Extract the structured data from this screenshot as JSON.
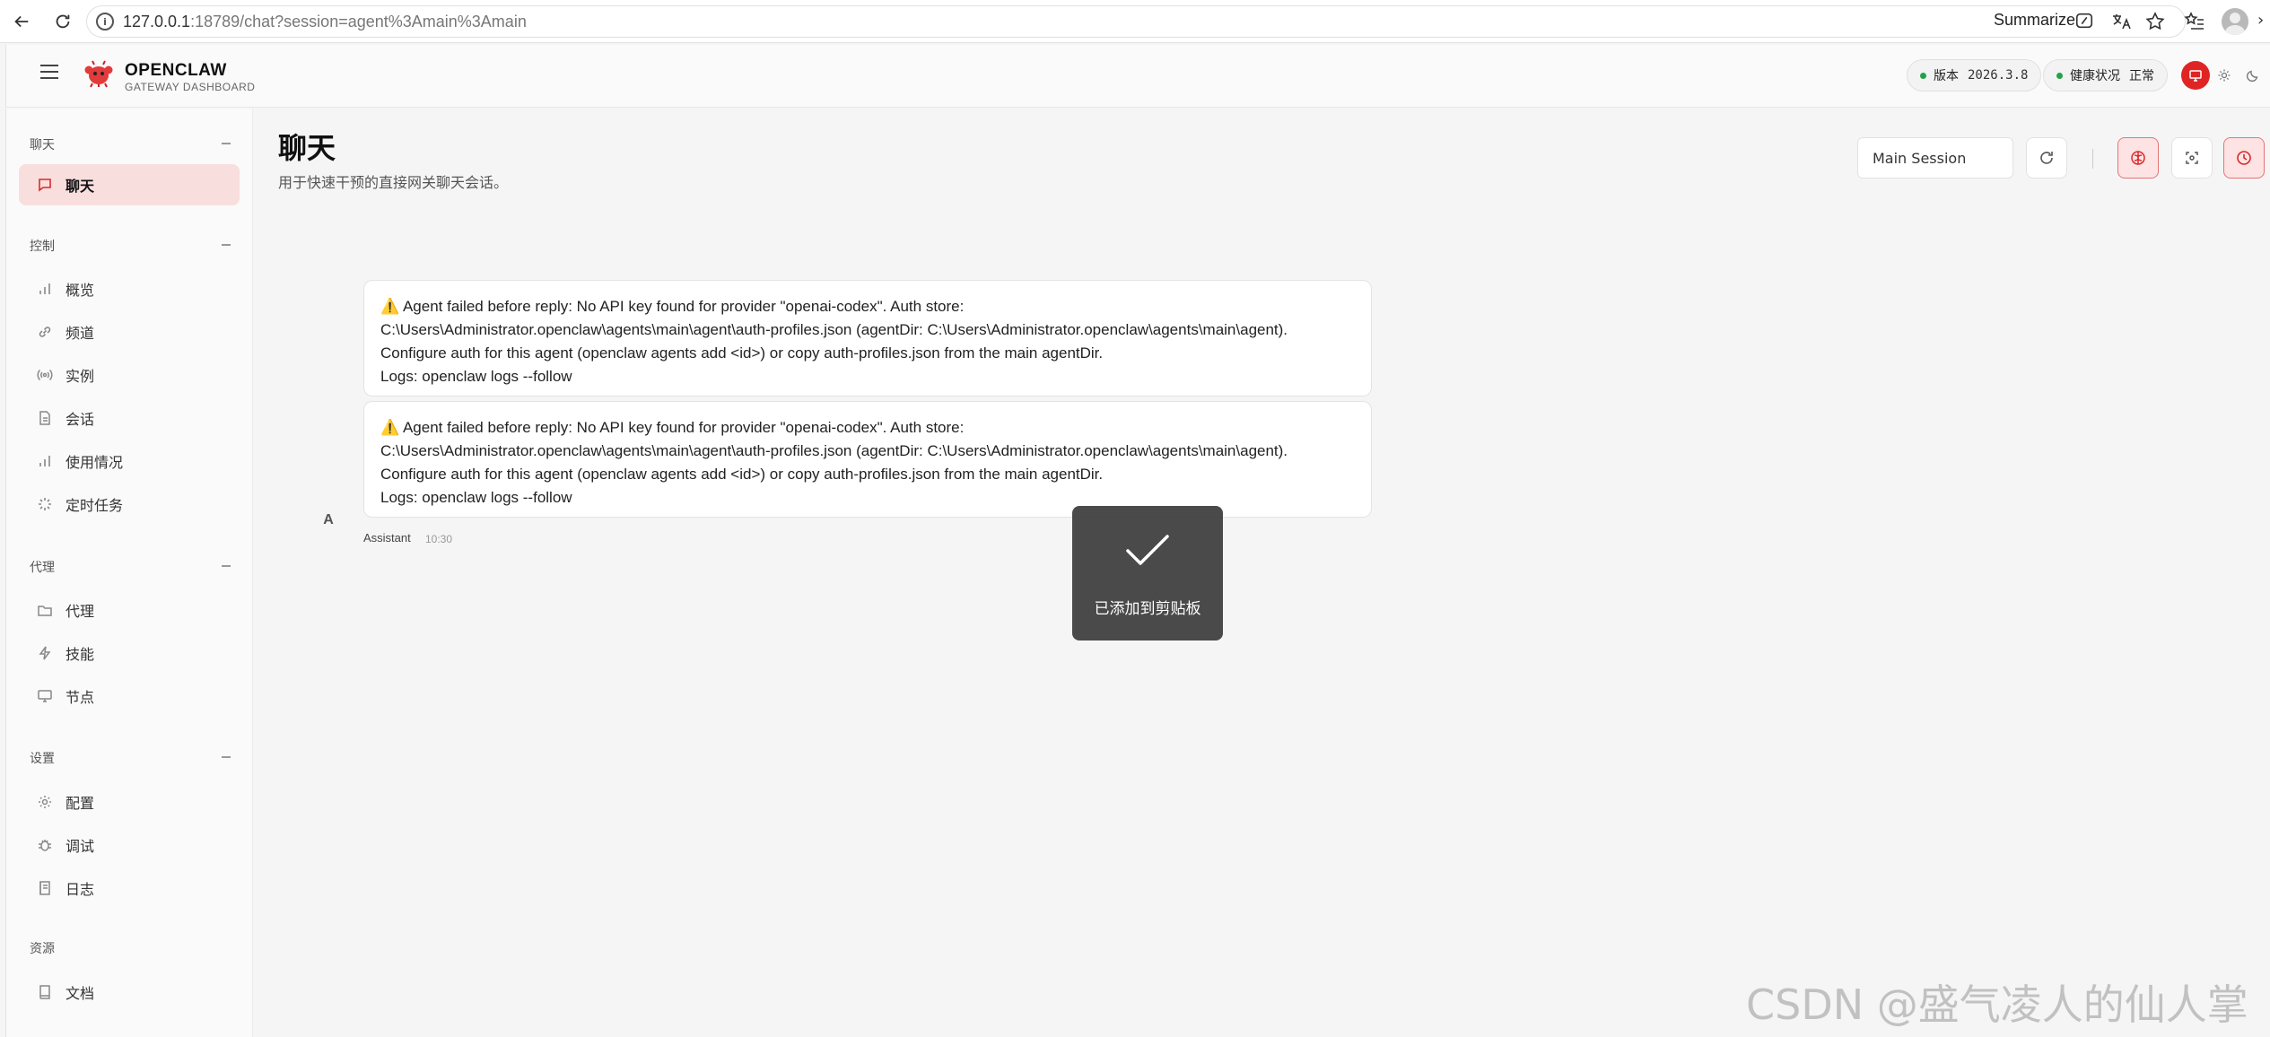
{
  "browser": {
    "url_host": "127.0.0.1",
    "url_rest": ":18789/chat?session=agent%3Amain%3Amain",
    "summarize_label": "Summarize"
  },
  "app": {
    "brand_title": "OPENCLAW",
    "brand_subtitle": "GATEWAY DASHBOARD",
    "version_label": "版本",
    "version_value": "2026.3.8",
    "health_label": "健康状况",
    "health_value": "正常"
  },
  "sidebar": {
    "sections": [
      {
        "title": "聊天",
        "items": [
          {
            "label": "聊天",
            "icon": "chat-bubble-icon",
            "active": true
          }
        ]
      },
      {
        "title": "控制",
        "items": [
          {
            "label": "概览",
            "icon": "bar-chart-icon"
          },
          {
            "label": "频道",
            "icon": "link-icon"
          },
          {
            "label": "实例",
            "icon": "broadcast-icon"
          },
          {
            "label": "会话",
            "icon": "document-icon"
          },
          {
            "label": "使用情况",
            "icon": "bar-chart-icon"
          },
          {
            "label": "定时任务",
            "icon": "spinner-icon"
          }
        ]
      },
      {
        "title": "代理",
        "items": [
          {
            "label": "代理",
            "icon": "folder-icon"
          },
          {
            "label": "技能",
            "icon": "lightning-icon"
          },
          {
            "label": "节点",
            "icon": "monitor-icon"
          }
        ]
      },
      {
        "title": "设置",
        "items": [
          {
            "label": "配置",
            "icon": "gear-icon"
          },
          {
            "label": "调试",
            "icon": "bug-icon"
          },
          {
            "label": "日志",
            "icon": "log-icon"
          }
        ]
      },
      {
        "title": "资源",
        "items": [
          {
            "label": "文档",
            "icon": "book-icon"
          }
        ]
      }
    ]
  },
  "main": {
    "title": "聊天",
    "subtitle": "用于快速干预的直接网关聊天会话。",
    "session_select_value": "Main Session",
    "messages": [
      {
        "lines": [
          "⚠️ Agent failed before reply: No API key found for provider \"openai-codex\". Auth store:",
          "C:\\Users\\Administrator.openclaw\\agents\\main\\agent\\auth-profiles.json (agentDir: C:\\Users\\Administrator.openclaw\\agents\\main\\agent).",
          "Configure auth for this agent (openclaw agents add <id>) or copy auth-profiles.json from the main agentDir.",
          "Logs: openclaw logs --follow"
        ]
      },
      {
        "lines": [
          "⚠️ Agent failed before reply: No API key found for provider \"openai-codex\". Auth store:",
          "C:\\Users\\Administrator.openclaw\\agents\\main\\agent\\auth-profiles.json (agentDir: C:\\Users\\Administrator.openclaw\\agents\\main\\agent).",
          "Configure auth for this agent (openclaw agents add <id>) or copy auth-profiles.json from the main agentDir.",
          "Logs: openclaw logs --follow"
        ]
      }
    ],
    "avatar_letter": "A",
    "sender_name": "Assistant",
    "sender_time": "10:30"
  },
  "toast": {
    "text": "已添加到剪贴板"
  },
  "watermark": "CSDN @盛气凌人的仙人掌",
  "colors": {
    "accent": "#e02424",
    "active_bg": "#f9dede",
    "status_ok": "#22a34a"
  }
}
